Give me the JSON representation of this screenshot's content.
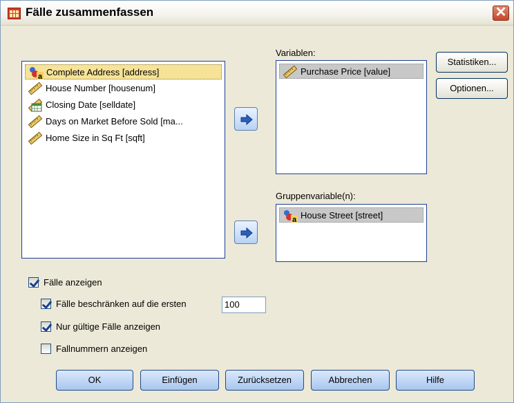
{
  "window": {
    "title": "Fälle zusammenfassen",
    "close_glyph": "✕"
  },
  "source_list": {
    "items": [
      {
        "label": "Complete Address [address]",
        "icon": "string-variable-icon",
        "selected": true
      },
      {
        "label": "House Number [housenum]",
        "icon": "scale-variable-icon",
        "selected": false
      },
      {
        "label": "Closing Date [selldate]",
        "icon": "date-variable-icon",
        "selected": false
      },
      {
        "label": "Days on Market Before Sold [ma...",
        "icon": "scale-variable-icon",
        "selected": false
      },
      {
        "label": "Home Size in Sq Ft [sqft]",
        "icon": "scale-variable-icon",
        "selected": false
      }
    ]
  },
  "variables": {
    "label": "Variablen:",
    "items": [
      {
        "label": "Purchase Price [value]",
        "icon": "scale-variable-icon",
        "selected": true
      }
    ]
  },
  "grouping": {
    "label": "Gruppenvariable(n):",
    "items": [
      {
        "label": "House Street [street]",
        "icon": "string-variable-icon",
        "selected": true
      }
    ]
  },
  "side_buttons": {
    "statistics": "Statistiken...",
    "options": "Optionen..."
  },
  "checkboxes": {
    "show_cases": {
      "label": "Fälle anzeigen",
      "checked": true
    },
    "limit_cases": {
      "label": "Fälle beschränken auf die ersten",
      "checked": true,
      "value": "100"
    },
    "valid_only": {
      "label": "Nur gültige Fälle anzeigen",
      "checked": true
    },
    "case_numbers": {
      "label": "Fallnummern anzeigen",
      "checked": false
    }
  },
  "bottom_buttons": {
    "ok": "OK",
    "paste": "Einfügen",
    "reset": "Zurücksetzen",
    "cancel": "Abbrechen",
    "help": "Hilfe"
  }
}
